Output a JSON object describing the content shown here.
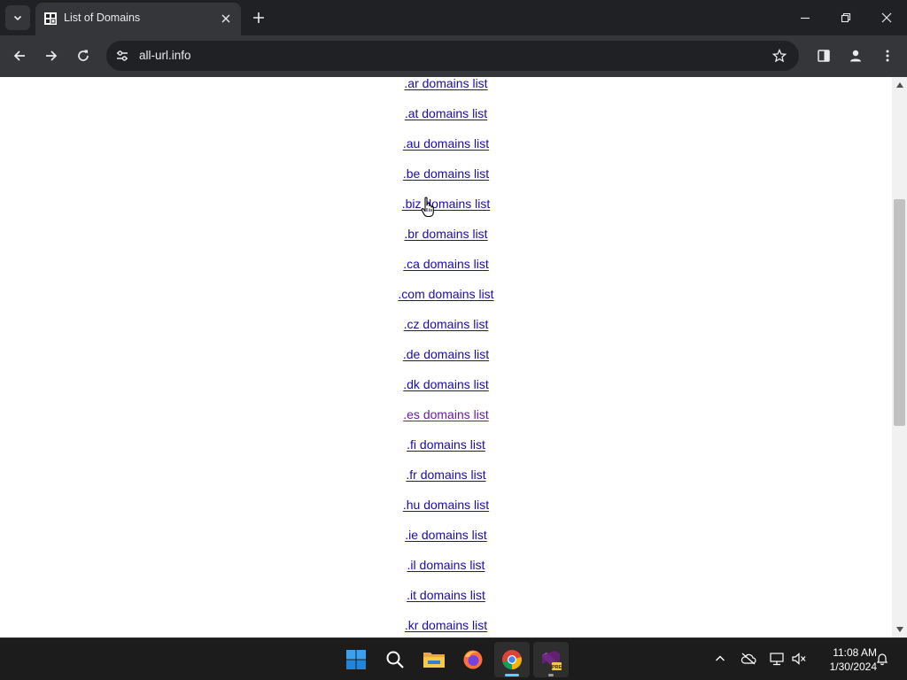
{
  "browser": {
    "tab_title": "List of Domains",
    "url": "all-url.info"
  },
  "page": {
    "links": [
      {
        "label": ".ar domains list",
        "visited": false
      },
      {
        "label": ".at domains list",
        "visited": false
      },
      {
        "label": ".au domains list",
        "visited": false
      },
      {
        "label": ".be domains list",
        "visited": false
      },
      {
        "label": ".biz domains list",
        "visited": false
      },
      {
        "label": ".br domains list",
        "visited": false
      },
      {
        "label": ".ca domains list",
        "visited": false
      },
      {
        "label": ".com domains list",
        "visited": false
      },
      {
        "label": ".cz domains list",
        "visited": false
      },
      {
        "label": ".de domains list",
        "visited": false
      },
      {
        "label": ".dk domains list",
        "visited": false
      },
      {
        "label": ".es domains list",
        "visited": true
      },
      {
        "label": ".fi domains list",
        "visited": false
      },
      {
        "label": ".fr domains list",
        "visited": false
      },
      {
        "label": ".hu domains list",
        "visited": false
      },
      {
        "label": ".ie domains list",
        "visited": false
      },
      {
        "label": ".il domains list",
        "visited": false
      },
      {
        "label": ".it domains list",
        "visited": false
      },
      {
        "label": ".kr domains list",
        "visited": false
      }
    ]
  },
  "colors": {
    "link": "#1a0dab",
    "link_visited": "#681da8",
    "accent": "#60cdff"
  },
  "taskbar": {
    "apps": [
      "start-icon",
      "search-icon",
      "file-explorer-icon",
      "firefox-icon",
      "chrome-icon",
      "visual-studio-preview-icon"
    ],
    "time": "11:08 AM",
    "date": "1/30/2024"
  }
}
